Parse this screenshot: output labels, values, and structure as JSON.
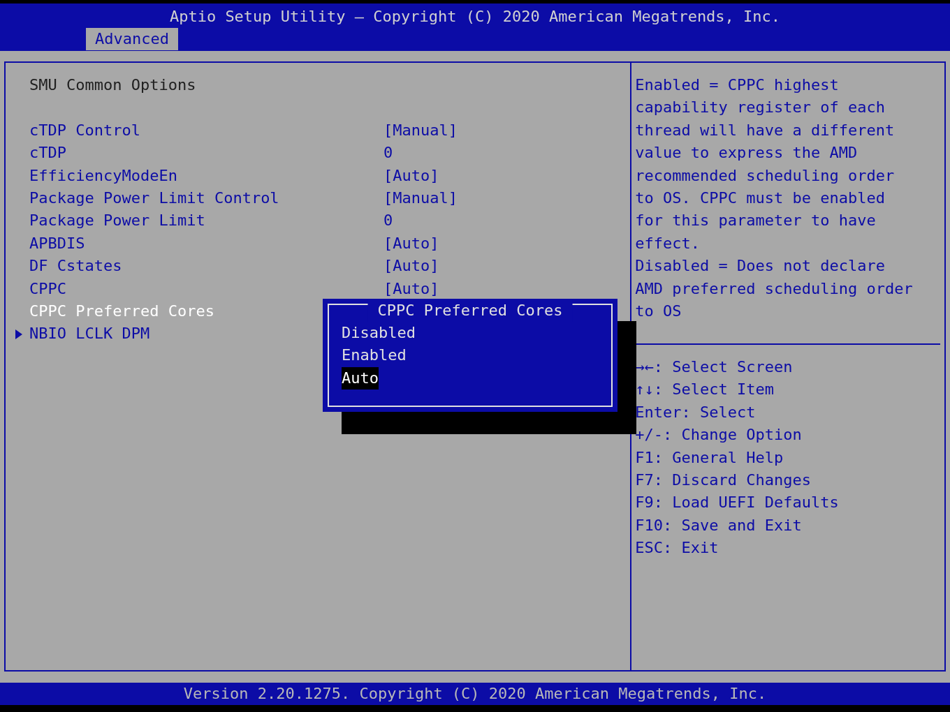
{
  "header": {
    "title": "Aptio Setup Utility – Copyright (C) 2020 American Megatrends, Inc.",
    "tabs": [
      {
        "label": "Advanced",
        "selected": true
      }
    ]
  },
  "section_title": "SMU Common Options",
  "settings": [
    {
      "label": "cTDP Control",
      "value": "[Manual]",
      "selected": false,
      "submenu": false
    },
    {
      "label": "cTDP",
      "value": "0",
      "selected": false,
      "submenu": false
    },
    {
      "label": "EfficiencyModeEn",
      "value": "[Auto]",
      "selected": false,
      "submenu": false
    },
    {
      "label": "Package Power Limit Control",
      "value": "[Manual]",
      "selected": false,
      "submenu": false
    },
    {
      "label": "Package Power Limit",
      "value": "0",
      "selected": false,
      "submenu": false
    },
    {
      "label": "APBDIS",
      "value": "[Auto]",
      "selected": false,
      "submenu": false
    },
    {
      "label": "DF Cstates",
      "value": "[Auto]",
      "selected": false,
      "submenu": false
    },
    {
      "label": "CPPC",
      "value": "[Auto]",
      "selected": false,
      "submenu": false
    },
    {
      "label": "CPPC Preferred Cores",
      "selected": true,
      "submenu": false
    },
    {
      "label": "NBIO LCLK DPM",
      "selected": false,
      "submenu": true
    }
  ],
  "popup": {
    "title": "CPPC Preferred Cores",
    "options": [
      {
        "label": "Disabled",
        "selected": false
      },
      {
        "label": "Enabled",
        "selected": false
      },
      {
        "label": "Auto",
        "selected": true
      }
    ]
  },
  "help_lines": [
    "Enabled = CPPC highest",
    "capability register of each",
    "thread will have a different",
    "value to express the AMD",
    "recommended scheduling order",
    "to OS. CPPC must be enabled",
    "for this parameter to have",
    "effect.",
    "Disabled = Does not declare",
    "AMD preferred scheduling order",
    "to OS"
  ],
  "keys": [
    "→←: Select Screen",
    "↑↓: Select Item",
    "Enter: Select",
    "+/-: Change Option",
    "F1: General Help",
    "F7: Discard Changes",
    "F9: Load UEFI Defaults",
    "F10: Save and Exit",
    "ESC: Exit"
  ],
  "footer": "Version 2.20.1275. Copyright (C) 2020 American Megatrends, Inc."
}
